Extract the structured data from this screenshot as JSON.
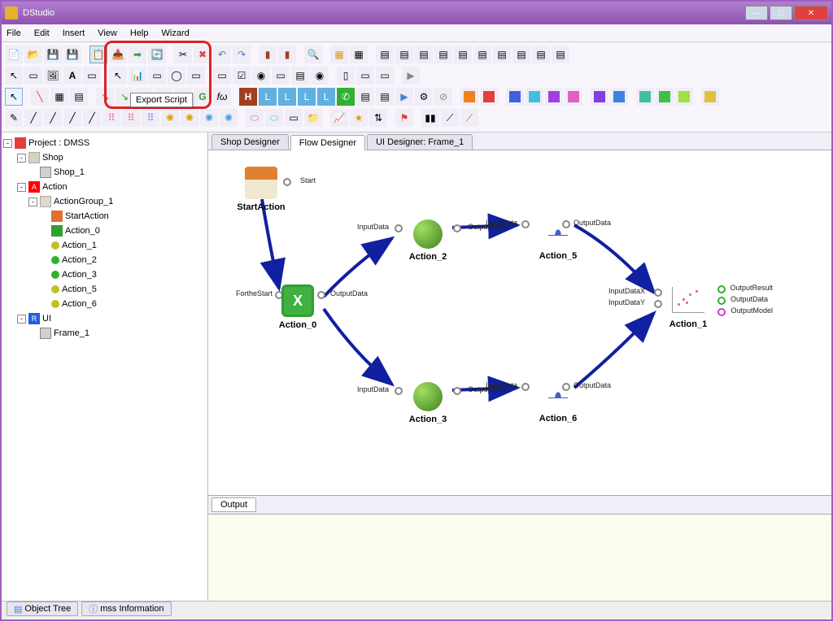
{
  "window": {
    "title": "DStudio"
  },
  "menu": {
    "file": "File",
    "edit": "Edit",
    "insert": "Insert",
    "view": "View",
    "help": "Help",
    "wizard": "Wizard"
  },
  "tooltip": {
    "export_script": "Export Script"
  },
  "tree": {
    "root": "Project : DMSS",
    "shop": "Shop",
    "shop1": "Shop_1",
    "action": "Action",
    "actiongroup": "ActionGroup_1",
    "startaction": "StartAction",
    "a0": "Action_0",
    "a1": "Action_1",
    "a2": "Action_2",
    "a3": "Action_3",
    "a5": "Action_5",
    "a6": "Action_6",
    "ui": "UI",
    "frame1": "Frame_1"
  },
  "tabs": {
    "shop": "Shop Designer",
    "flow": "Flow Designer",
    "ui": "UI Designer: Frame_1"
  },
  "nodes": {
    "start": {
      "label": "StartAction",
      "port_start": "Start"
    },
    "a0": {
      "label": "Action_0",
      "p_in": "FortheStart",
      "p_out": "OutputData"
    },
    "a2": {
      "label": "Action_2",
      "p_in": "InputData",
      "p_out": "OutputData"
    },
    "a3": {
      "label": "Action_3",
      "p_in": "InputData",
      "p_out": "OutputData"
    },
    "a5": {
      "label": "Action_5",
      "p_in": "InputData",
      "p_out": "OutputData"
    },
    "a6": {
      "label": "Action_6",
      "p_in": "InputData",
      "p_out": "OutputData"
    },
    "a1": {
      "label": "Action_1",
      "p_inx": "InputDataX",
      "p_iny": "InputDataY",
      "p_or": "OutputResult",
      "p_od": "OutputData",
      "p_om": "OutputModel"
    }
  },
  "output": {
    "tab": "Output"
  },
  "bottom": {
    "obj": "Object Tree",
    "mss": "mss Information"
  }
}
